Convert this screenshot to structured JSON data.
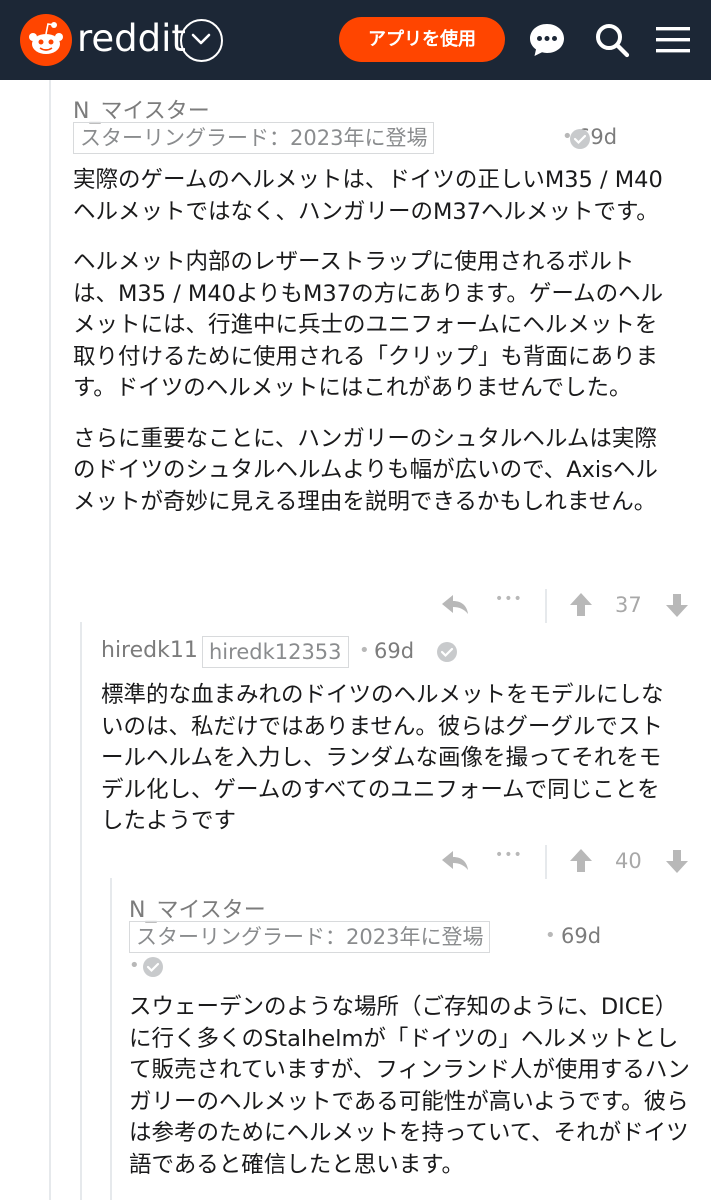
{
  "header": {
    "logo_text": "reddit",
    "app_button": "アプリを使用",
    "brand_color": "#ff4500",
    "bg_color": "#1c2736",
    "icons": [
      "reddit-logo-icon",
      "chevron-down-icon",
      "chat-icon",
      "search-icon",
      "menu-icon"
    ]
  },
  "comments": [
    {
      "author": "N_マイスター",
      "flair": "スターリングラード：2023年に登場",
      "dot": "•",
      "age": "69d",
      "paragraphs": [
        "実際のゲームのヘルメットは、ドイツの正しいM35 / M40ヘルメットではなく、ハンガリーのM37ヘルメットです。",
        "ヘルメット内部のレザーストラップに使用されるボルトは、M35 / M40よりもM37の方にあります。ゲームのヘルメットには、行進中に兵士のユニフォームにヘルメットを取り付けるために使用される「クリップ」も背面にあります。ドイツのヘルメットにはこれがありませんでした。",
        "さらに重要なことに、ハンガリーのシュタルヘルムは実際のドイツのシュタルヘルムよりも幅が広いので、Axisヘルメットが奇妙に見える理由を説明できるかもしれません。"
      ],
      "votes": "37",
      "more": "•••"
    },
    {
      "author": "hiredk11",
      "flair": "hiredk12353",
      "dot": "•",
      "age": "69d",
      "paragraphs": [
        "標準的な血まみれのドイツのヘルメットをモデルにしないのは、私だけではありません。彼らはグーグルでストールヘルムを入力し、ランダムな画像を撮ってそれをモデル化し、ゲームのすべてのユニフォームで同じことをしたようです"
      ],
      "votes": "40",
      "more": "•••"
    },
    {
      "author": "N_マイスター",
      "flair": "スターリングラード：2023年に登場",
      "dot": "•",
      "age": "69d",
      "paragraphs": [
        "スウェーデンのような場所（ご存知のように、DICE）に行く多くのStalhelmが「ドイツの」ヘルメットとして販売されていますが、フィンランド人が使用するハンガリーのヘルメットである可能性が高いようです。彼らは参考のためにヘルメットを持っていて、それがドイツ語であると確信したと思います。"
      ]
    }
  ]
}
